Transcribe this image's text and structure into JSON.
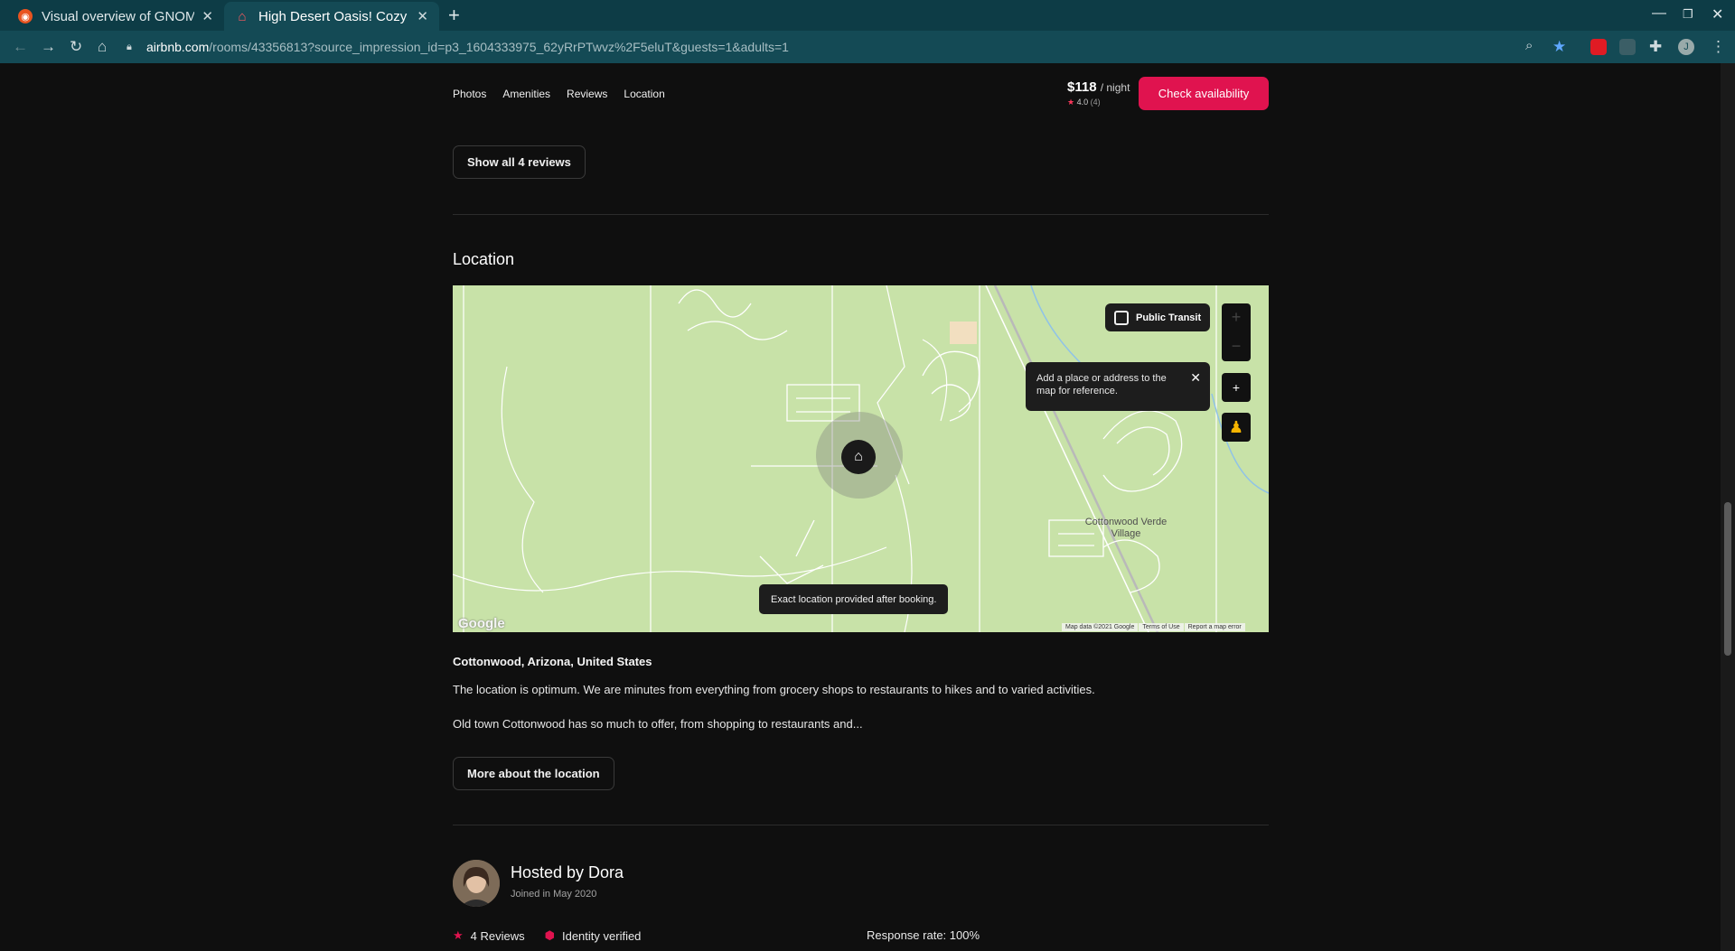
{
  "browser": {
    "tabs": [
      {
        "title": "Visual overview of GNOM",
        "favicon": "ubuntu-icon"
      },
      {
        "title": "High Desert Oasis! Cozy h",
        "favicon": "airbnb-icon"
      }
    ],
    "url_host": "airbnb.com",
    "url_rest": "/rooms/43356813?source_impression_id=p3_1604333975_62yRrPTwvz%2F5eluT&guests=1&adults=1",
    "profile_initial": "J"
  },
  "subnav": {
    "links": [
      "Photos",
      "Amenities",
      "Reviews",
      "Location"
    ],
    "price": "$118",
    "per_night": "/ night",
    "rating": "4.0",
    "rating_count": "(4)",
    "check_label": "Check availability"
  },
  "reviews": {
    "show_all_label": "Show all 4 reviews"
  },
  "location": {
    "title": "Location",
    "map": {
      "transit_label": "Public Transit",
      "tooltip": "Add a place or address to the map for reference.",
      "exact_notice": "Exact location provided after booking.",
      "place_label": "Cottonwood Verde Village",
      "logo": "Google",
      "footer": [
        "Map data ©2021 Google",
        "Terms of Use",
        "Report a map error"
      ],
      "colors": {
        "land": "#c8e2a8",
        "roads": "#ffffff"
      }
    },
    "place": "Cottonwood, Arizona, United States",
    "para1": "The location is optimum. We are minutes from everything from grocery shops to restaurants to hikes and to varied activities.",
    "para2": "Old town Cottonwood has so much to offer, from shopping to restaurants and...",
    "more_label": "More about the location"
  },
  "host": {
    "name": "Hosted by Dora",
    "joined": "Joined in May 2020",
    "reviews": "4 Reviews",
    "verified": "Identity verified",
    "response_rate": "Response rate: 100%"
  },
  "colors": {
    "accent": "#e0134f",
    "background": "#0f0f0f"
  }
}
